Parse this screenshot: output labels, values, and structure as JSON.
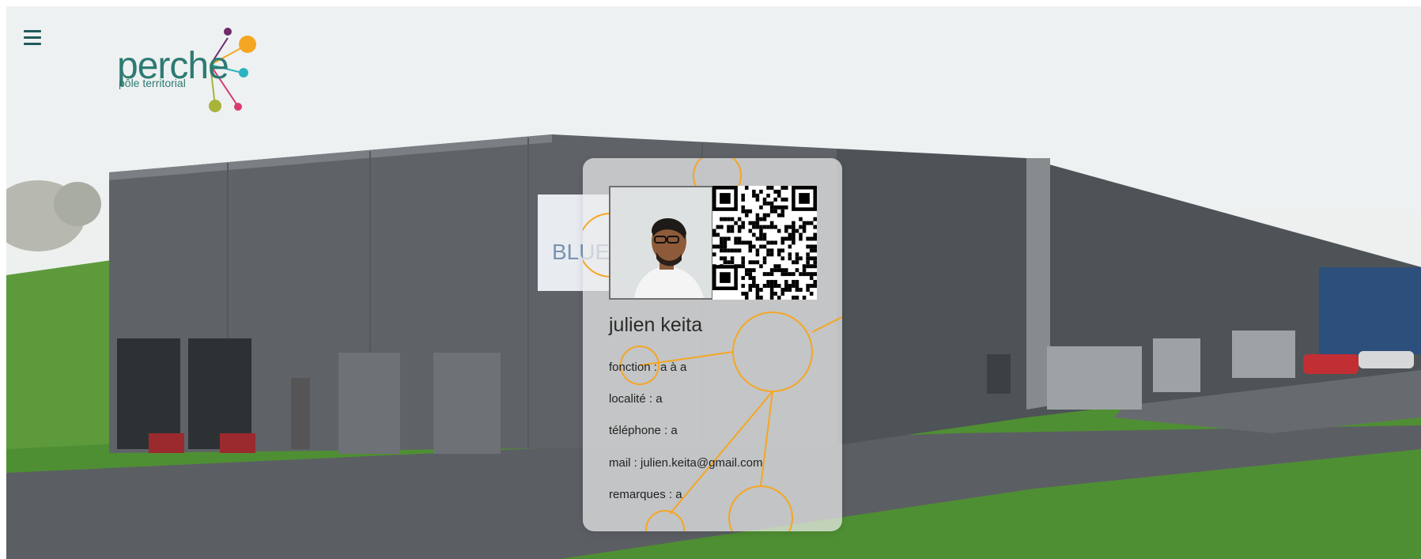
{
  "header": {
    "menu_icon": "hamburger-icon",
    "logo": {
      "word": "perche",
      "subtitle": "pôle territorial",
      "colors": {
        "teal": "#2d7b74",
        "purple": "#6e2a6a",
        "orange": "#f5a623",
        "cyan": "#2ab3c0",
        "pink": "#d93a6e",
        "olive": "#a9b33a"
      }
    }
  },
  "card": {
    "name": "julien keita",
    "fields": [
      {
        "label": "fonction : a à a"
      },
      {
        "label": "localité : a"
      },
      {
        "label": "téléphone : a"
      },
      {
        "label": "mail : julien.keita@gmail.com"
      },
      {
        "label": "remarques : a"
      }
    ],
    "photo_alt": "profile-photo",
    "qr_icon": "qr-code-icon",
    "accent_color": "#f5a623"
  }
}
